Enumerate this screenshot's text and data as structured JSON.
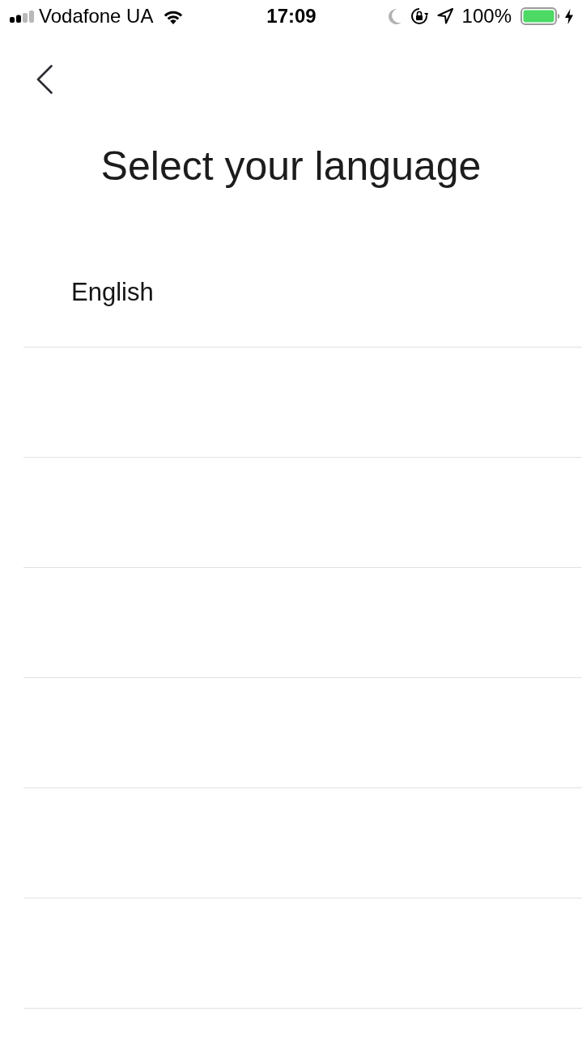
{
  "status_bar": {
    "carrier": "Vodafone UA",
    "time": "17:09",
    "battery": "100%"
  },
  "header": {
    "title": "Select your language"
  },
  "languages": [
    {
      "label": "English"
    }
  ]
}
